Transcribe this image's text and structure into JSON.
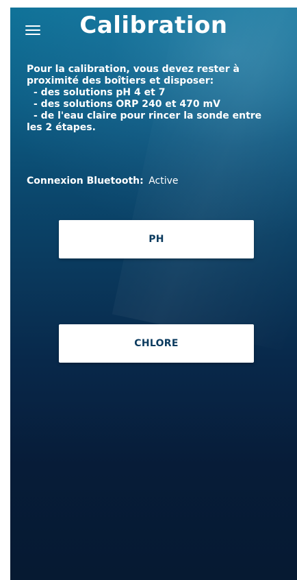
{
  "header": {
    "title": "Calibration",
    "menu_icon": "hamburger-menu-icon"
  },
  "instructions": {
    "lines": [
      "Pour la calibration, vous devez rester à",
      "proximité des boîtiers et disposer:",
      "- des solutions pH 4 et 7",
      "- des solutions ORP 240 et 470 mV",
      "- de l'eau claire pour rincer la sonde entre",
      "les 2 étapes."
    ]
  },
  "bluetooth": {
    "label": "Connexion Bluetooth:",
    "status": "Active"
  },
  "buttons": {
    "ph_label": "PH",
    "chlore_label": "CHLORE"
  },
  "colors": {
    "background_top": "#0f7298",
    "background_bottom": "#061a32",
    "button_bg": "#ffffff",
    "button_text": "#0a3a5e"
  }
}
